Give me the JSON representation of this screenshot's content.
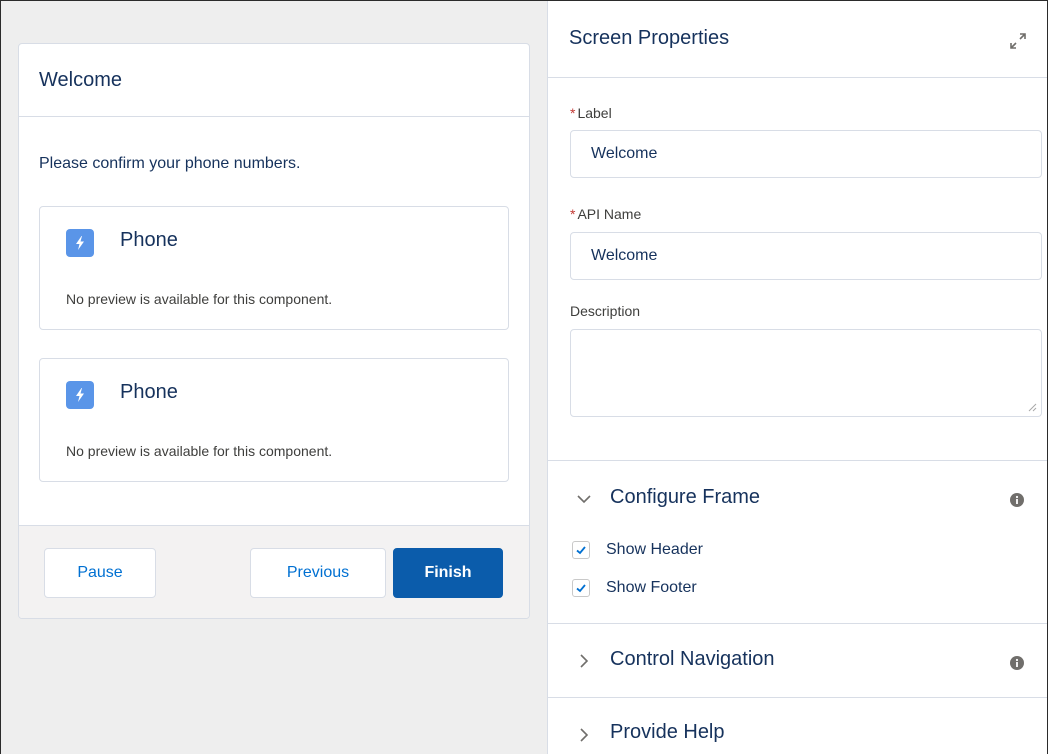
{
  "screen": {
    "title": "Welcome",
    "prompt": "Please confirm your phone numbers.",
    "components": [
      {
        "name": "Phone",
        "note": "No preview is available for this component."
      },
      {
        "name": "Phone",
        "note": "No preview is available for this component."
      }
    ],
    "footer": {
      "pause": "Pause",
      "previous": "Previous",
      "finish": "Finish"
    }
  },
  "properties": {
    "title": "Screen Properties",
    "label_field": {
      "label": "Label",
      "required_mark": "*",
      "value": "Welcome"
    },
    "api_field": {
      "label": "API Name",
      "required_mark": "*",
      "value": "Welcome"
    },
    "description_field": {
      "label": "Description",
      "value": ""
    },
    "sections": {
      "configure_frame": {
        "title": "Configure Frame",
        "expanded": true,
        "options": [
          {
            "label": "Show Header",
            "checked": true
          },
          {
            "label": "Show Footer",
            "checked": true
          }
        ]
      },
      "control_navigation": {
        "title": "Control Navigation",
        "expanded": false
      },
      "provide_help": {
        "title": "Provide Help",
        "expanded": false
      }
    }
  },
  "colors": {
    "brand": "#0b5cab",
    "link": "#0070d2",
    "component_icon": "#5a95e8",
    "required": "#c23934",
    "text": "#16325c"
  },
  "icons": {
    "component": "lightning-bolt-icon",
    "expand": "expand-arrows-icon",
    "info": "info-icon",
    "collapse_open": "chevron-down-icon",
    "collapse_closed": "chevron-right-icon",
    "check": "checkmark-icon"
  }
}
